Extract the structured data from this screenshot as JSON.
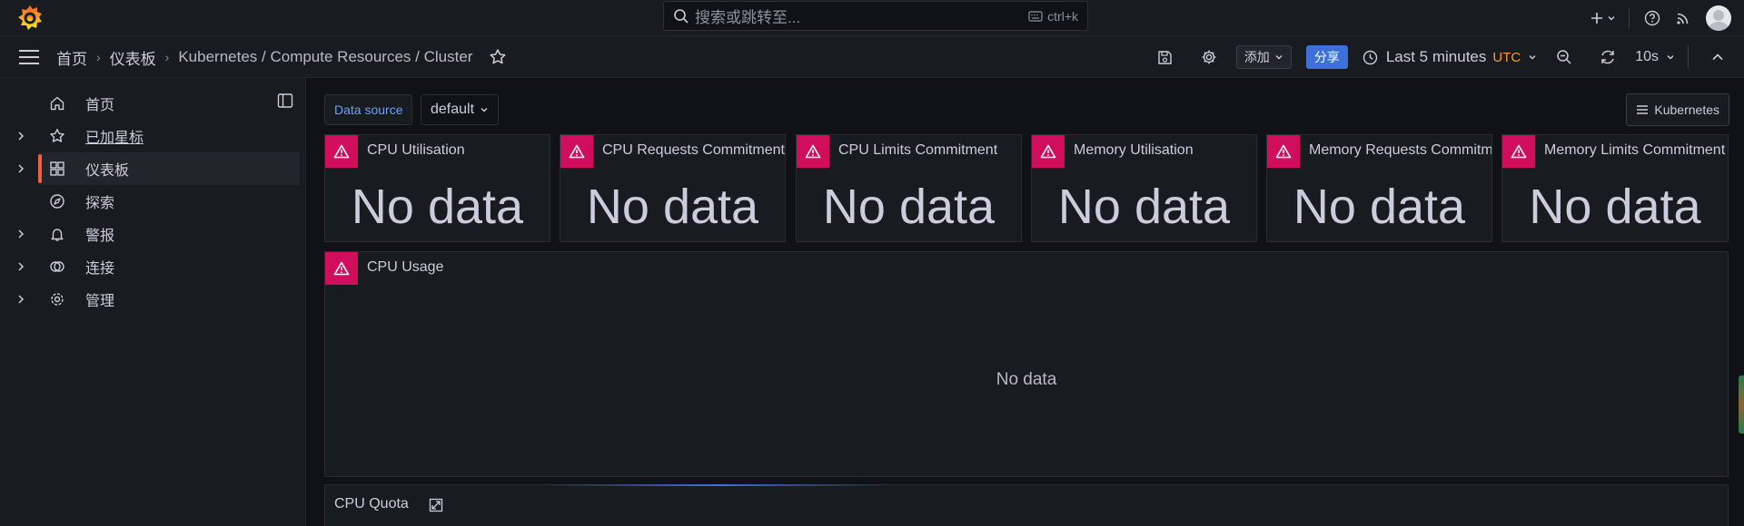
{
  "topbar": {
    "search_placeholder": "搜索或跳转至...",
    "search_shortcut": "ctrl+k",
    "icons": [
      "grafana-logo-icon",
      "search-icon",
      "keyboard-icon",
      "plus-icon",
      "chevron-down-icon",
      "help-icon",
      "rss-icon",
      "avatar"
    ]
  },
  "navbar": {
    "breadcrumbs": [
      "首页",
      "仪表板",
      "Kubernetes / Compute Resources / Cluster"
    ],
    "add_label": "添加",
    "share_label": "分享",
    "time_range": "Last 5 minutes",
    "timezone": "UTC",
    "refresh_interval": "10s"
  },
  "sidebar": {
    "items": [
      {
        "label": "首页",
        "icon": "home-icon",
        "expandable": false
      },
      {
        "label": "已加星标",
        "icon": "star-icon",
        "expandable": true
      },
      {
        "label": "仪表板",
        "icon": "dashboards-icon",
        "expandable": true,
        "active": true
      },
      {
        "label": "探索",
        "icon": "compass-icon",
        "expandable": false
      },
      {
        "label": "警报",
        "icon": "bell-icon",
        "expandable": true
      },
      {
        "label": "连接",
        "icon": "connections-icon",
        "expandable": true
      },
      {
        "label": "管理",
        "icon": "gear-icon",
        "expandable": true
      }
    ]
  },
  "dashboard": {
    "datasource_label": "Data source",
    "datasource_value": "default",
    "links_button": "Kubernetes",
    "stat_panels": [
      {
        "title": "CPU Utilisation",
        "value": "No data"
      },
      {
        "title": "CPU Requests Commitment",
        "value": "No data"
      },
      {
        "title": "CPU Limits Commitment",
        "value": "No data"
      },
      {
        "title": "Memory Utilisation",
        "value": "No data"
      },
      {
        "title": "Memory Requests Commitment",
        "value": "No data"
      },
      {
        "title": "Memory Limits Commitment",
        "value": "No data"
      }
    ],
    "graph_panel": {
      "title": "CPU Usage",
      "value": "No data"
    },
    "row": {
      "title": "CPU Quota"
    }
  },
  "colors": {
    "background": "#111217",
    "panel": "#181b1f",
    "error": "#d10e5c",
    "primary": "#3d71d9",
    "utc": "#ff9830",
    "active_bar": "#f55f3e"
  }
}
